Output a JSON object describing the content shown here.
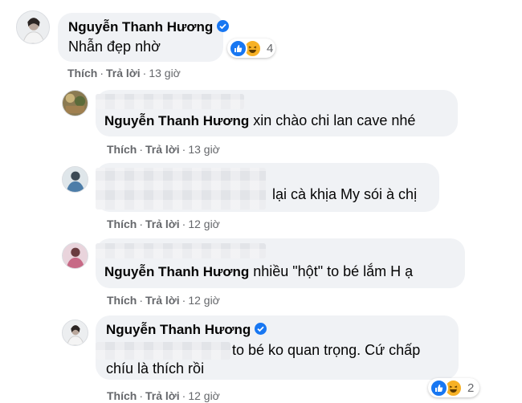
{
  "comments": [
    {
      "author": "Nguyễn Thanh Hương",
      "text": "Nhẫn đẹp nhờ",
      "actions": {
        "like": "Thích",
        "reply": "Trả lời",
        "time": "13 giờ"
      },
      "reactions": {
        "icons": [
          "like-icon",
          "haha-icon"
        ],
        "count": "4"
      }
    },
    {
      "mention": "Nguyễn Thanh Hương",
      "text": "xin chào chi lan cave nhé",
      "actions": {
        "like": "Thích",
        "reply": "Trả lời",
        "time": "13 giờ"
      }
    },
    {
      "text": "lại cà khịa My sói à chị",
      "actions": {
        "like": "Thích",
        "reply": "Trả lời",
        "time": "12 giờ"
      }
    },
    {
      "mention": "Nguyễn Thanh Hương",
      "text": "nhiều \"hột\" to bé lắm H ạ",
      "actions": {
        "like": "Thích",
        "reply": "Trả lời",
        "time": "12 giờ"
      }
    },
    {
      "author": "Nguyễn Thanh Hương",
      "text_line1": "to bé ko quan trọng. Cứ chấp",
      "text_line2": "chíu là thích rồi",
      "actions": {
        "like": "Thích",
        "reply": "Trả lời",
        "time": "12 giờ"
      },
      "reactions": {
        "icons": [
          "like-icon",
          "haha-icon"
        ],
        "count": "2"
      }
    }
  ],
  "colors": {
    "bubble": "#f0f2f5",
    "verified": "#1877f2",
    "like": "#1877f2",
    "haha": "#f7b125",
    "meta": "#65676b"
  }
}
